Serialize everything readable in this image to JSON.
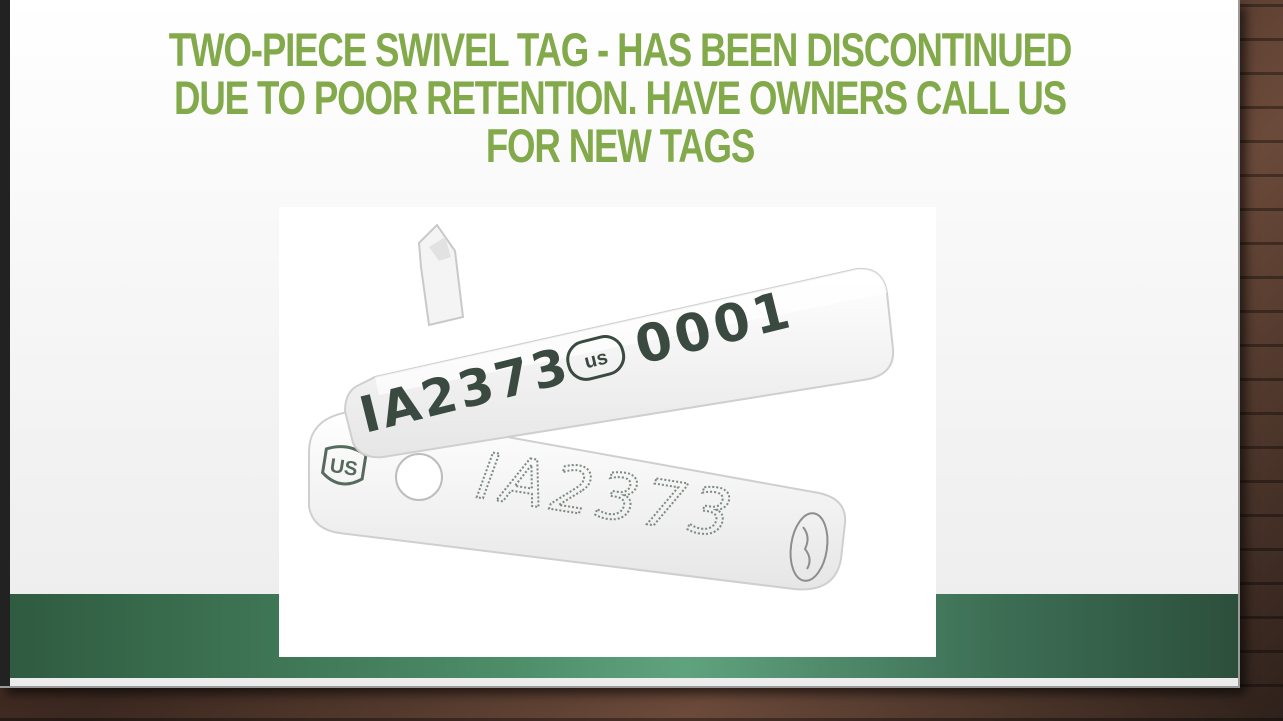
{
  "slide": {
    "title": "TWO-PIECE SWIVEL TAG - HAS BEEN DISCONTINUED DUE TO POOR RETENTION. HAVE OWNERS CALL US FOR NEW TAGS"
  },
  "tag_photo": {
    "top_tag": {
      "id_text": "IA2373",
      "badge": "us",
      "serial": "0001"
    },
    "bottom_tag": {
      "badge": "US",
      "id_text": "IA2373"
    }
  },
  "colors": {
    "title": "#82a94a",
    "band": "#4c8d68",
    "tag_text": "#3a4a40"
  }
}
